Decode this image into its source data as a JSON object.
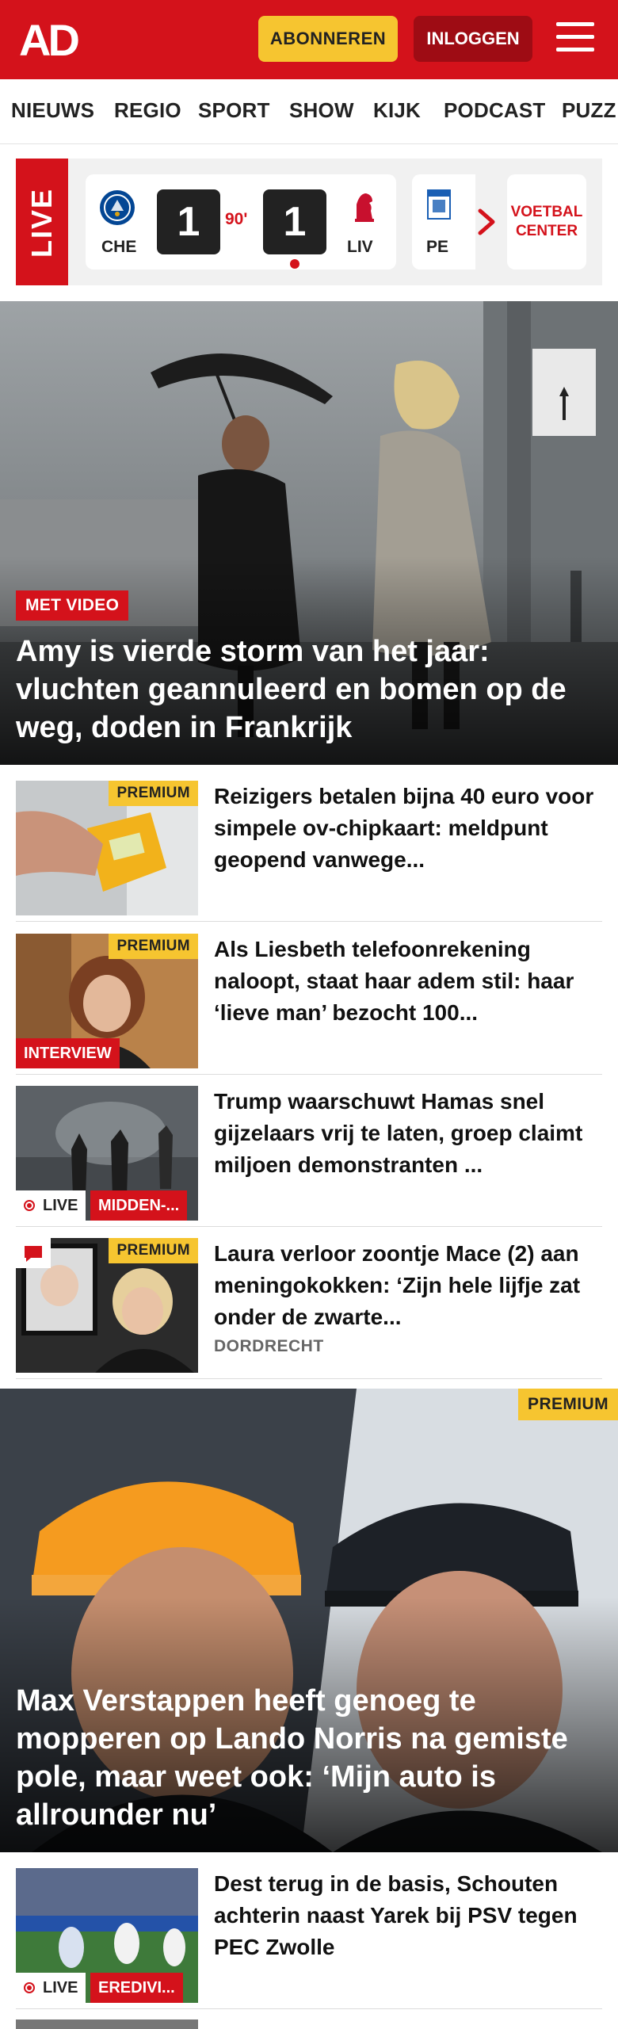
{
  "header": {
    "logo_text": "AD",
    "subscribe_label": "ABONNEREN",
    "login_label": "INLOGGEN",
    "menu_icon": "hamburger-menu-icon",
    "brand_color": "#d4121b",
    "accent_color": "#f6c530"
  },
  "nav": {
    "items": [
      "NIEUWS",
      "REGIO",
      "SPORT",
      "SHOW",
      "KIJK",
      "PODCAST",
      "PUZZ"
    ]
  },
  "live_strip": {
    "tag": "LIVE",
    "match": {
      "home_code": "CHE",
      "home_score": "1",
      "minute": "90'",
      "away_score": "1",
      "away_code": "LIV"
    },
    "next_match_code": "PE",
    "voetbal_center_label": "VOETBAL CENTER"
  },
  "hero": {
    "badge": "MET VIDEO",
    "title": "Amy is vierde storm van het jaar: vluchten geannuleerd en bomen op de weg, doden in Frankrijk"
  },
  "articles": [
    {
      "premium": "PREMIUM",
      "title": "Reizigers betalen bijna 40 euro voor simpele ov-chipkaart: meldpunt geopend vanwege..."
    },
    {
      "premium": "PREMIUM",
      "category": "INTERVIEW",
      "title": "Als Liesbeth telefoonrekening naloopt, staat haar adem stil: haar ‘lieve man’ bezocht 100..."
    },
    {
      "live": "LIVE",
      "category": "MIDDEN-...",
      "title": "Trump waarschuwt Hamas snel gijzelaars vrij te laten, groep claimt miljoen demonstranten ..."
    },
    {
      "premium": "PREMIUM",
      "title": "Laura verloor zoontje Mace (2) aan meningokokken: ‘Zijn hele lijfje zat onder de zwarte...",
      "meta": "DORDRECHT"
    }
  ],
  "feature": {
    "premium": "PREMIUM",
    "title": "Max Verstappen heeft genoeg te mopperen op Lando Norris na gemiste pole, maar weet ook: ‘Mijn auto is allrounder nu’"
  },
  "articles_bottom": [
    {
      "live": "LIVE",
      "category": "EREDIVI...",
      "title": "Dest terug in de basis, Schouten achterin naast Yarek bij PSV tegen PEC Zwolle"
    }
  ]
}
